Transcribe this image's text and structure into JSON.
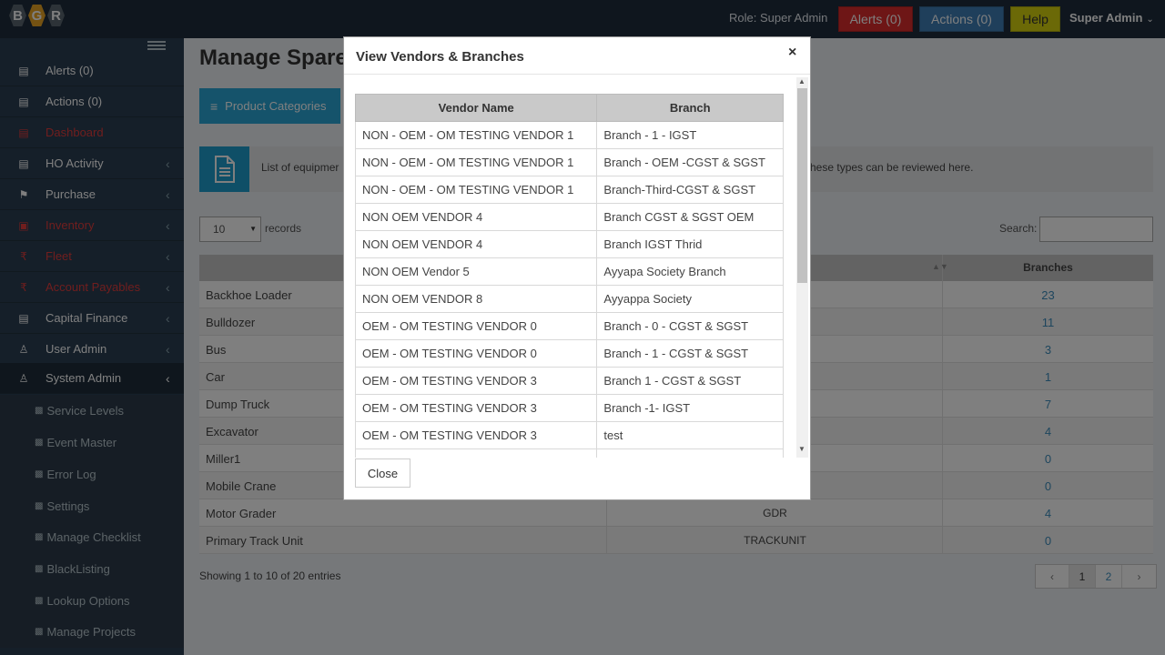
{
  "topbar": {
    "logo_letters": [
      "B",
      "G",
      "R"
    ],
    "role": "Role: Super Admin",
    "alerts_btn": "Alerts (0)",
    "actions_btn": "Actions (0)",
    "help_btn": "Help",
    "user": "Super Admin"
  },
  "sidebar": {
    "items": [
      {
        "label": "Alerts (0)",
        "icon": "chart-icon"
      },
      {
        "label": "Actions (0)",
        "icon": "chart-icon"
      },
      {
        "label": "Dashboard",
        "icon": "chart-icon"
      },
      {
        "label": "HO Activity",
        "icon": "chart-icon"
      },
      {
        "label": "Purchase",
        "icon": "flag-icon"
      },
      {
        "label": "Inventory",
        "icon": "box-icon"
      },
      {
        "label": "Fleet",
        "icon": "rupee-icon"
      },
      {
        "label": "Account Payables",
        "icon": "rupee-icon"
      },
      {
        "label": "Capital Finance",
        "icon": "chart-icon"
      },
      {
        "label": "User Admin",
        "icon": "users-icon"
      },
      {
        "label": "System Admin",
        "icon": "users-icon"
      }
    ],
    "sub_items": [
      "Service Levels",
      "Event Master",
      "Error Log",
      "Settings",
      "Manage Checklist",
      "BlackListing",
      "Lookup Options",
      "Manage Projects"
    ]
  },
  "main": {
    "title": "Manage Spare",
    "categories_btn": "Product Categories",
    "info_left": "List of equipmer",
    "info_right": "hese types can be reviewed here.",
    "page_len": "10",
    "records_label": "records",
    "search_label": "Search:",
    "col_branches": "Branches",
    "rows": [
      {
        "name": "Backhoe Loader",
        "code": "",
        "branches": "23"
      },
      {
        "name": "Bulldozer",
        "code": "",
        "branches": "11"
      },
      {
        "name": "Bus",
        "code": "",
        "branches": "3"
      },
      {
        "name": "Car",
        "code": "",
        "branches": "1"
      },
      {
        "name": "Dump Truck",
        "code": "",
        "branches": "7"
      },
      {
        "name": "Excavator",
        "code": "",
        "branches": "4"
      },
      {
        "name": "Miller1",
        "code": "",
        "branches": "0"
      },
      {
        "name": "Mobile Crane",
        "code": "",
        "branches": "0"
      },
      {
        "name": "Motor Grader",
        "code": "GDR",
        "branches": "4"
      },
      {
        "name": "Primary Track Unit",
        "code": "TRACKUNIT",
        "branches": "0"
      }
    ],
    "showing": "Showing 1 to 10 of 20 entries",
    "pager": {
      "prev": "‹",
      "pages": [
        "1",
        "2"
      ],
      "next": "›"
    }
  },
  "modal": {
    "title": "View Vendors & Branches",
    "close_x": "×",
    "headers": [
      "Vendor Name",
      "Branch"
    ],
    "rows": [
      [
        "NON - OEM - OM TESTING VENDOR 1",
        "Branch - 1 - IGST"
      ],
      [
        "NON - OEM - OM TESTING VENDOR 1",
        "Branch - OEM -CGST & SGST"
      ],
      [
        "NON - OEM - OM TESTING VENDOR 1",
        "Branch-Third-CGST & SGST"
      ],
      [
        "NON OEM VENDOR 4",
        "Branch CGST & SGST OEM"
      ],
      [
        "NON OEM VENDOR 4",
        "Branch IGST Thrid"
      ],
      [
        "NON OEM Vendor 5",
        "Ayyapa Society Branch"
      ],
      [
        "NON OEM VENDOR 8",
        "Ayyappa Society"
      ],
      [
        "OEM - OM TESTING VENDOR 0",
        "Branch - 0 - CGST & SGST"
      ],
      [
        "OEM - OM TESTING VENDOR 0",
        "Branch - 1 - CGST & SGST"
      ],
      [
        "OEM - OM TESTING VENDOR 3",
        "Branch 1 - CGST & SGST"
      ],
      [
        "OEM - OM TESTING VENDOR 3",
        "Branch -1- IGST"
      ],
      [
        "OEM - OM TESTING VENDOR 3",
        "test"
      ],
      [
        "",
        ""
      ]
    ],
    "close_btn": "Close"
  },
  "colors": {
    "topbar": "#1f2d3d",
    "sidebar": "#2a3e52",
    "alerts": "#dd2c2c",
    "actions": "#3f7fb6",
    "help": "#d6d20f",
    "accent": "#2aa6d6",
    "link": "#3c8dbc"
  }
}
